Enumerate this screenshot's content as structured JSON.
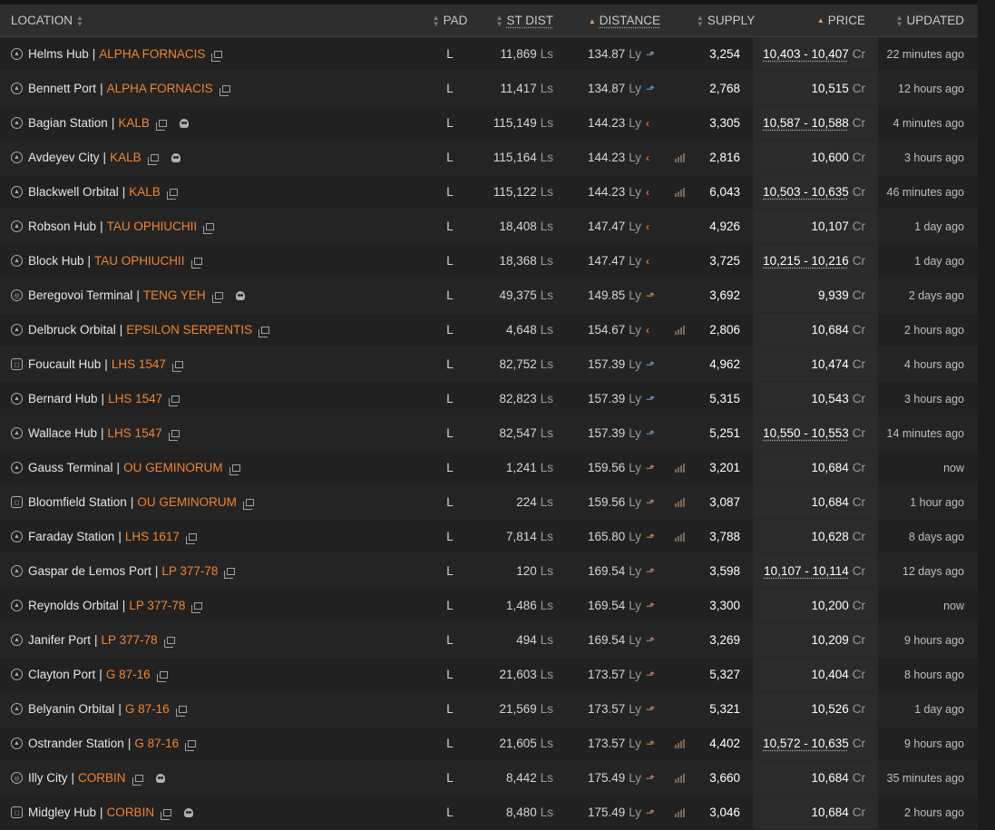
{
  "columns": {
    "location": "LOCATION",
    "pad": "PAD",
    "st_dist": "ST DIST",
    "distance": "DISTANCE",
    "supply": "SUPPLY",
    "price": "PRICE",
    "updated": "UPDATED"
  },
  "sort": {
    "active_columns": [
      "distance",
      "price"
    ],
    "accent_color": "#f7a052"
  },
  "colors": {
    "system_link": "#f08432",
    "trend_up": "#6fa0c9",
    "trend_left": "#e06a3a"
  },
  "rows": [
    {
      "station": "Helms Hub",
      "system": "ALPHA FORNACIS",
      "station_icon": "coriolis-icon",
      "skull": false,
      "pad": "L",
      "st_dist": "11,869",
      "st_unit": "Ls",
      "distance": "134.87",
      "dist_unit": "Ly",
      "dir_icon": "up",
      "dir_glyph": "⬏",
      "chart": false,
      "supply": "3,254",
      "price": "10,403 - 10,407",
      "range": true,
      "cr": "Cr",
      "updated": "22 minutes ago"
    },
    {
      "station": "Bennett Port",
      "system": "ALPHA FORNACIS",
      "station_icon": "coriolis-icon",
      "skull": false,
      "pad": "L",
      "st_dist": "11,417",
      "st_unit": "Ls",
      "distance": "134.87",
      "dist_unit": "Ly",
      "dir_icon": "up",
      "dir_glyph": "⬏",
      "chart": false,
      "supply": "2,768",
      "price": "10,515",
      "range": false,
      "cr": "Cr",
      "updated": "12 hours ago"
    },
    {
      "station": "Bagian Station",
      "system": "KALB",
      "station_icon": "coriolis-icon",
      "skull": true,
      "pad": "L",
      "st_dist": "115,149",
      "st_unit": "Ls",
      "distance": "144.23",
      "dist_unit": "Ly",
      "dir_icon": "left",
      "dir_glyph": "‹",
      "chart": false,
      "supply": "3,305",
      "price": "10,587 - 10,588",
      "range": true,
      "cr": "Cr",
      "updated": "4 minutes ago"
    },
    {
      "station": "Avdeyev City",
      "system": "KALB",
      "station_icon": "coriolis-icon",
      "skull": true,
      "pad": "L",
      "st_dist": "115,164",
      "st_unit": "Ls",
      "distance": "144.23",
      "dist_unit": "Ly",
      "dir_icon": "left",
      "dir_glyph": "‹",
      "chart": true,
      "supply": "2,816",
      "price": "10,600",
      "range": false,
      "cr": "Cr",
      "updated": "3 hours ago"
    },
    {
      "station": "Blackwell Orbital",
      "system": "KALB",
      "station_icon": "coriolis-icon",
      "skull": false,
      "pad": "L",
      "st_dist": "115,122",
      "st_unit": "Ls",
      "distance": "144.23",
      "dist_unit": "Ly",
      "dir_icon": "left",
      "dir_glyph": "‹",
      "chart": true,
      "supply": "6,043",
      "price": "10,503 - 10,635",
      "range": true,
      "cr": "Cr",
      "updated": "46 minutes ago"
    },
    {
      "station": "Robson Hub",
      "system": "TAU OPHIUCHII",
      "station_icon": "coriolis-icon",
      "skull": false,
      "pad": "L",
      "st_dist": "18,408",
      "st_unit": "Ls",
      "distance": "147.47",
      "dist_unit": "Ly",
      "dir_icon": "left",
      "dir_glyph": "‹",
      "chart": false,
      "supply": "4,926",
      "price": "10,107",
      "range": false,
      "cr": "Cr",
      "updated": "1 day ago"
    },
    {
      "station": "Block Hub",
      "system": "TAU OPHIUCHII",
      "station_icon": "coriolis-icon",
      "skull": false,
      "pad": "L",
      "st_dist": "18,368",
      "st_unit": "Ls",
      "distance": "147.47",
      "dist_unit": "Ly",
      "dir_icon": "left",
      "dir_glyph": "‹",
      "chart": false,
      "supply": "3,725",
      "price": "10,215 - 10,216",
      "range": true,
      "cr": "Cr",
      "updated": "1 day ago"
    },
    {
      "station": "Beregovoi Terminal",
      "system": "TENG YEH",
      "station_icon": "orbis-icon",
      "skull": true,
      "pad": "L",
      "st_dist": "49,375",
      "st_unit": "Ls",
      "distance": "149.85",
      "dist_unit": "Ly",
      "dir_icon": "mid",
      "dir_glyph": "⬏",
      "chart": false,
      "supply": "3,692",
      "price": "9,939",
      "range": false,
      "cr": "Cr",
      "updated": "2 days ago"
    },
    {
      "station": "Delbruck Orbital",
      "system": "EPSILON SERPENTIS",
      "station_icon": "coriolis-icon",
      "skull": false,
      "pad": "L",
      "st_dist": "4,648",
      "st_unit": "Ls",
      "distance": "154.67",
      "dist_unit": "Ly",
      "dir_icon": "left",
      "dir_glyph": "‹",
      "chart": true,
      "supply": "2,806",
      "price": "10,684",
      "range": false,
      "cr": "Cr",
      "updated": "2 hours ago"
    },
    {
      "station": "Foucault Hub",
      "system": "LHS 1547",
      "station_icon": "ocellus-icon",
      "skull": false,
      "pad": "L",
      "st_dist": "82,752",
      "st_unit": "Ls",
      "distance": "157.39",
      "dist_unit": "Ly",
      "dir_icon": "up",
      "dir_glyph": "⬏",
      "chart": false,
      "supply": "4,962",
      "price": "10,474",
      "range": false,
      "cr": "Cr",
      "updated": "4 hours ago"
    },
    {
      "station": "Bernard Hub",
      "system": "LHS 1547",
      "station_icon": "coriolis-icon",
      "skull": false,
      "pad": "L",
      "st_dist": "82,823",
      "st_unit": "Ls",
      "distance": "157.39",
      "dist_unit": "Ly",
      "dir_icon": "up",
      "dir_glyph": "⬏",
      "chart": false,
      "supply": "5,315",
      "price": "10,543",
      "range": false,
      "cr": "Cr",
      "updated": "3 hours ago"
    },
    {
      "station": "Wallace Hub",
      "system": "LHS 1547",
      "station_icon": "coriolis-icon",
      "skull": false,
      "pad": "L",
      "st_dist": "82,547",
      "st_unit": "Ls",
      "distance": "157.39",
      "dist_unit": "Ly",
      "dir_icon": "up",
      "dir_glyph": "⬏",
      "chart": false,
      "supply": "5,251",
      "price": "10,550 - 10,553",
      "range": true,
      "cr": "Cr",
      "updated": "14 minutes ago"
    },
    {
      "station": "Gauss Terminal",
      "system": "OU GEMINORUM",
      "station_icon": "coriolis-icon",
      "skull": false,
      "pad": "L",
      "st_dist": "1,241",
      "st_unit": "Ls",
      "distance": "159.56",
      "dist_unit": "Ly",
      "dir_icon": "mid",
      "dir_glyph": "⬏",
      "chart": true,
      "supply": "3,201",
      "price": "10,684",
      "range": false,
      "cr": "Cr",
      "updated": "now"
    },
    {
      "station": "Bloomfield Station",
      "system": "OU GEMINORUM",
      "station_icon": "ocellus-icon",
      "skull": false,
      "pad": "L",
      "st_dist": "224",
      "st_unit": "Ls",
      "distance": "159.56",
      "dist_unit": "Ly",
      "dir_icon": "mid",
      "dir_glyph": "⬏",
      "chart": true,
      "supply": "3,087",
      "price": "10,684",
      "range": false,
      "cr": "Cr",
      "updated": "1 hour ago"
    },
    {
      "station": "Faraday Station",
      "system": "LHS 1617",
      "station_icon": "coriolis-icon",
      "skull": false,
      "pad": "L",
      "st_dist": "7,814",
      "st_unit": "Ls",
      "distance": "165.80",
      "dist_unit": "Ly",
      "dir_icon": "mid",
      "dir_glyph": "⬏",
      "chart": true,
      "supply": "3,788",
      "price": "10,628",
      "range": false,
      "cr": "Cr",
      "updated": "8 days ago"
    },
    {
      "station": "Gaspar de Lemos Port",
      "system": "LP 377-78",
      "station_icon": "coriolis-icon",
      "skull": false,
      "pad": "L",
      "st_dist": "120",
      "st_unit": "Ls",
      "distance": "169.54",
      "dist_unit": "Ly",
      "dir_icon": "mid",
      "dir_glyph": "⬏",
      "chart": false,
      "supply": "3,598",
      "price": "10,107 - 10,114",
      "range": true,
      "cr": "Cr",
      "updated": "12 days ago"
    },
    {
      "station": "Reynolds Orbital",
      "system": "LP 377-78",
      "station_icon": "coriolis-icon",
      "skull": false,
      "pad": "L",
      "st_dist": "1,486",
      "st_unit": "Ls",
      "distance": "169.54",
      "dist_unit": "Ly",
      "dir_icon": "mid",
      "dir_glyph": "⬏",
      "chart": false,
      "supply": "3,300",
      "price": "10,200",
      "range": false,
      "cr": "Cr",
      "updated": "now"
    },
    {
      "station": "Janifer Port",
      "system": "LP 377-78",
      "station_icon": "coriolis-icon",
      "skull": false,
      "pad": "L",
      "st_dist": "494",
      "st_unit": "Ls",
      "distance": "169.54",
      "dist_unit": "Ly",
      "dir_icon": "mid",
      "dir_glyph": "⬏",
      "chart": false,
      "supply": "3,269",
      "price": "10,209",
      "range": false,
      "cr": "Cr",
      "updated": "9 hours ago"
    },
    {
      "station": "Clayton Port",
      "system": "G 87-16",
      "station_icon": "coriolis-icon",
      "skull": false,
      "pad": "L",
      "st_dist": "21,603",
      "st_unit": "Ls",
      "distance": "173.57",
      "dist_unit": "Ly",
      "dir_icon": "mid",
      "dir_glyph": "⬏",
      "chart": false,
      "supply": "5,327",
      "price": "10,404",
      "range": false,
      "cr": "Cr",
      "updated": "8 hours ago"
    },
    {
      "station": "Belyanin Orbital",
      "system": "G 87-16",
      "station_icon": "coriolis-icon",
      "skull": false,
      "pad": "L",
      "st_dist": "21,569",
      "st_unit": "Ls",
      "distance": "173.57",
      "dist_unit": "Ly",
      "dir_icon": "mid",
      "dir_glyph": "⬏",
      "chart": false,
      "supply": "5,321",
      "price": "10,526",
      "range": false,
      "cr": "Cr",
      "updated": "1 day ago"
    },
    {
      "station": "Ostrander Station",
      "system": "G 87-16",
      "station_icon": "coriolis-icon",
      "skull": false,
      "pad": "L",
      "st_dist": "21,605",
      "st_unit": "Ls",
      "distance": "173.57",
      "dist_unit": "Ly",
      "dir_icon": "mid",
      "dir_glyph": "⬏",
      "chart": true,
      "supply": "4,402",
      "price": "10,572 - 10,635",
      "range": true,
      "cr": "Cr",
      "updated": "9 hours ago"
    },
    {
      "station": "Illy City",
      "system": "CORBIN",
      "station_icon": "orbis-icon",
      "skull": true,
      "pad": "L",
      "st_dist": "8,442",
      "st_unit": "Ls",
      "distance": "175.49",
      "dist_unit": "Ly",
      "dir_icon": "mid",
      "dir_glyph": "⬏",
      "chart": true,
      "supply": "3,660",
      "price": "10,684",
      "range": false,
      "cr": "Cr",
      "updated": "35 minutes ago"
    },
    {
      "station": "Midgley Hub",
      "system": "CORBIN",
      "station_icon": "ocellus-icon",
      "skull": true,
      "pad": "L",
      "st_dist": "8,480",
      "st_unit": "Ls",
      "distance": "175.49",
      "dist_unit": "Ly",
      "dir_icon": "mid",
      "dir_glyph": "⬏",
      "chart": true,
      "supply": "3,046",
      "price": "10,684",
      "range": false,
      "cr": "Cr",
      "updated": "2 hours ago"
    }
  ]
}
